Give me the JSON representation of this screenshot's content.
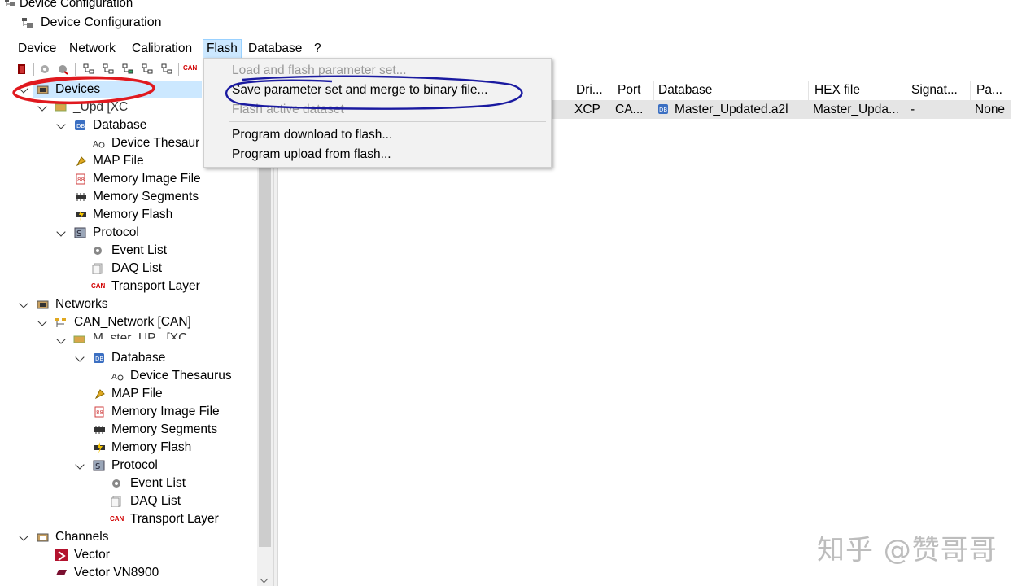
{
  "window": {
    "title": "Device Configuration",
    "subtitle": "Device Configuration"
  },
  "menubar": {
    "items": [
      "Device",
      "Network",
      "Calibration",
      "Flash",
      "Database",
      "?"
    ],
    "active": "Flash"
  },
  "flash_menu": {
    "items": [
      {
        "label": "Load and flash parameter set...",
        "enabled": false
      },
      {
        "label": "Save parameter set and merge to binary file...",
        "enabled": true
      },
      {
        "label": "Flash active dataset",
        "enabled": false
      },
      {
        "label": "Program download to flash...",
        "enabled": true
      },
      {
        "label": "Program upload from flash...",
        "enabled": true
      }
    ]
  },
  "tree": {
    "devices": "Devices",
    "device_node": "_Upd  [XC",
    "db1": "Database",
    "thes1": "Device Thesaur",
    "map1": "MAP File",
    "mif1": "Memory Image File",
    "mseg1": "Memory Segments",
    "mflash1": "Memory Flash",
    "proto1": "Protocol",
    "ev1": "Event List",
    "daq1": "DAQ List",
    "tl1": "Transport Layer",
    "networks": "Networks",
    "can_network": "CAN_Network [CAN]",
    "net_device": "M_ster_UP_  [XC",
    "db2": "Database",
    "thes2": "Device Thesaurus",
    "map2": "MAP File",
    "mif2": "Memory Image File",
    "mseg2": "Memory Segments",
    "mflash2": "Memory Flash",
    "proto2": "Protocol",
    "ev2": "Event List",
    "daq2": "DAQ List",
    "tl2": "Transport Layer",
    "channels": "Channels",
    "vector": "Vector",
    "vn8900": "Vector VN8900"
  },
  "grid": {
    "headers": [
      "Dri...",
      "Port",
      "Database",
      "HEX file",
      "Signat...",
      "Pa..."
    ],
    "row": [
      "XCP",
      "CA...",
      "Master_Updated.a2l",
      "Master_Upda...",
      "-",
      "None"
    ]
  },
  "icons": {
    "can_label": "CAN"
  },
  "watermark": "知乎 @赞哥哥",
  "colors": {
    "selection": "#cce8ff",
    "red_annotation": "#e0191f",
    "blue_annotation": "#1a1aa0"
  }
}
